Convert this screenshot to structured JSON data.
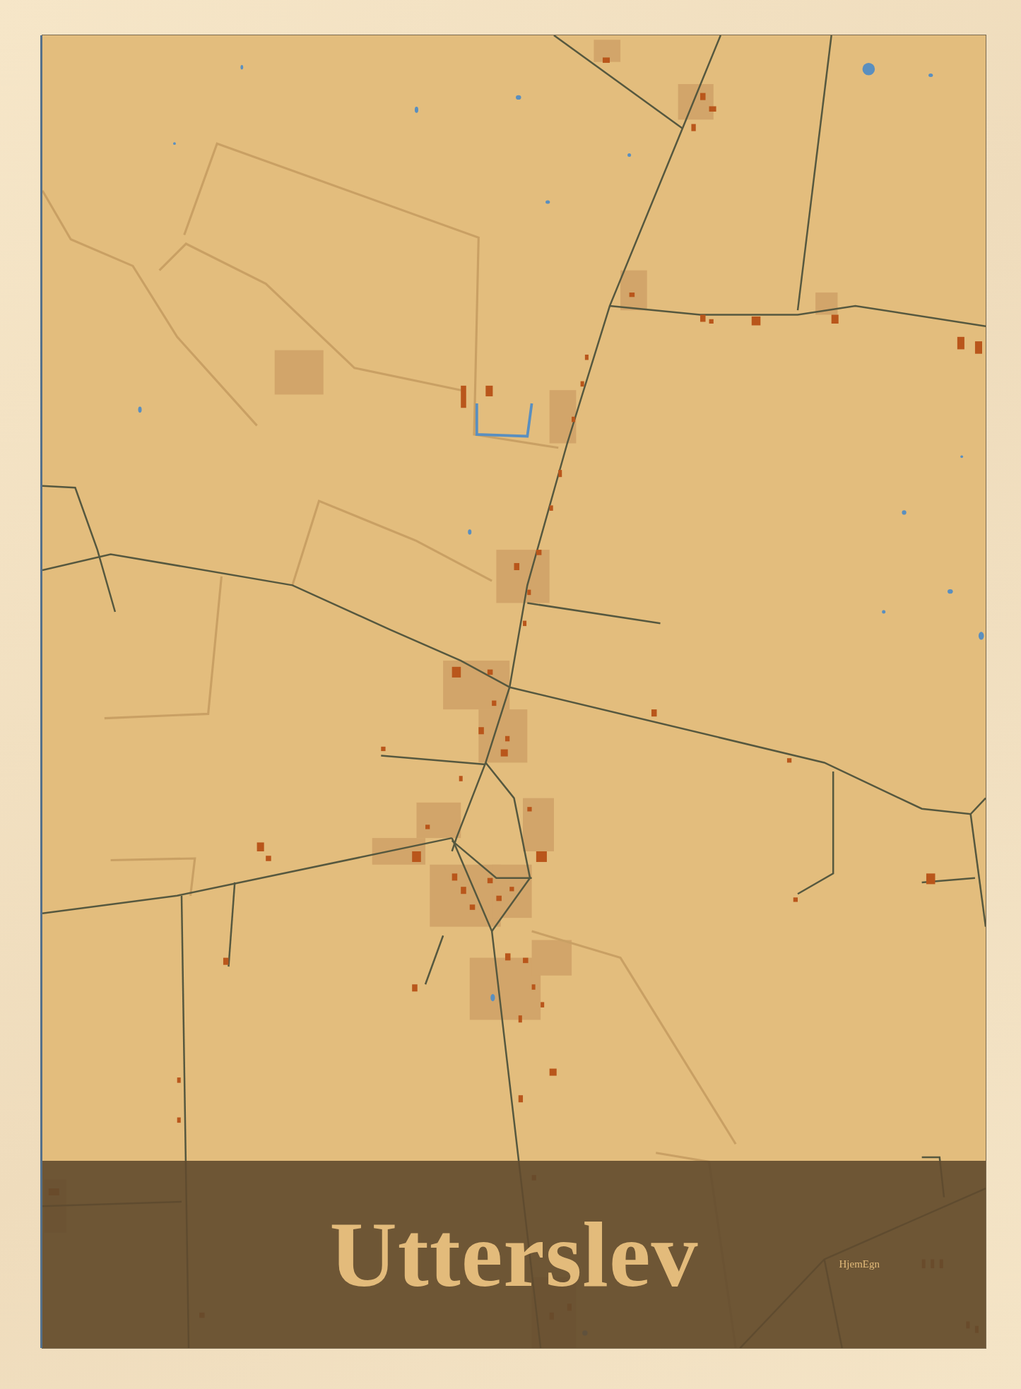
{
  "poster": {
    "title": "Utterslev",
    "logo": "HjemEgn"
  }
}
